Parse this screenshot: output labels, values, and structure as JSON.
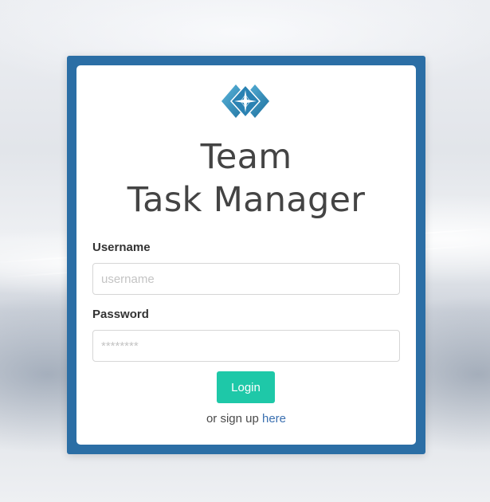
{
  "app": {
    "title_line1": "Team",
    "title_line2": "Task Manager",
    "logo_icon": "diamond-star-logo-icon"
  },
  "form": {
    "username_label": "Username",
    "username_placeholder": "username",
    "username_value": "",
    "password_label": "Password",
    "password_placeholder": "********",
    "password_value": "",
    "login_label": "Login"
  },
  "signup": {
    "prefix": "or sign up",
    "link_label": "here"
  },
  "colors": {
    "frame": "#2b6ea5",
    "login_button": "#1ec8a8",
    "link": "#3a6fb0",
    "title_text": "#444444"
  }
}
